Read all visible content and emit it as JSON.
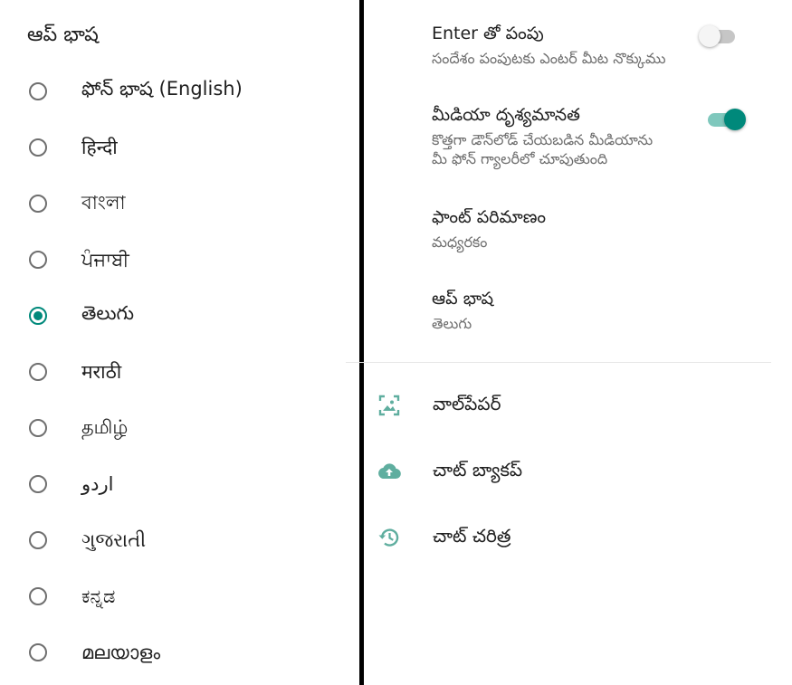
{
  "language_dialog": {
    "title": "ఆప్ భాష",
    "options": [
      {
        "label": "ఫోన్ భాష (English)",
        "selected": false
      },
      {
        "label": "हिन्दी",
        "selected": false
      },
      {
        "label": "বাংলা",
        "selected": false
      },
      {
        "label": "ਪੰਜਾਬੀ",
        "selected": false
      },
      {
        "label": "తెలుగు",
        "selected": true
      },
      {
        "label": "मराठी",
        "selected": false
      },
      {
        "label": "தமிழ்",
        "selected": false
      },
      {
        "label": "اردو",
        "selected": false
      },
      {
        "label": "ગુજરાતી",
        "selected": false
      },
      {
        "label": "ಕನ್ನಡ",
        "selected": false
      },
      {
        "label": "മലയാളം",
        "selected": false
      }
    ]
  },
  "settings": {
    "enter_send": {
      "title": "Enter తో పంపు",
      "subtitle": "సందేశం పంపుటకు ఎంటర్ మీట నొక్కుము",
      "enabled": false
    },
    "media_visibility": {
      "title": "మీడియా దృశ్యమానత",
      "subtitle_line1": "కొత్తగా డౌన్‌లోడ్ చేయబడిన మీడియాను",
      "subtitle_line2": "మీ ఫోన్ గ్యాలరీలో చూపుతుంది",
      "enabled": true
    },
    "font_size": {
      "title": "ఫాంట్ పరిమాణం",
      "value": "మధ్యరకం"
    },
    "app_language": {
      "title": "ఆప్ భాష",
      "value": "తెలుగు"
    }
  },
  "nav": {
    "wallpaper": {
      "label": "వాల్‌పేపర్",
      "icon": "wallpaper-icon"
    },
    "chat_backup": {
      "label": "చాట్ బ్యాకప్",
      "icon": "cloud-upload-icon"
    },
    "chat_history": {
      "label": "చాట్ చరిత్ర",
      "icon": "history-icon"
    }
  },
  "colors": {
    "accent": "#00897b",
    "accent_track": "#7fc8bd",
    "icon": "#5fae9f"
  }
}
